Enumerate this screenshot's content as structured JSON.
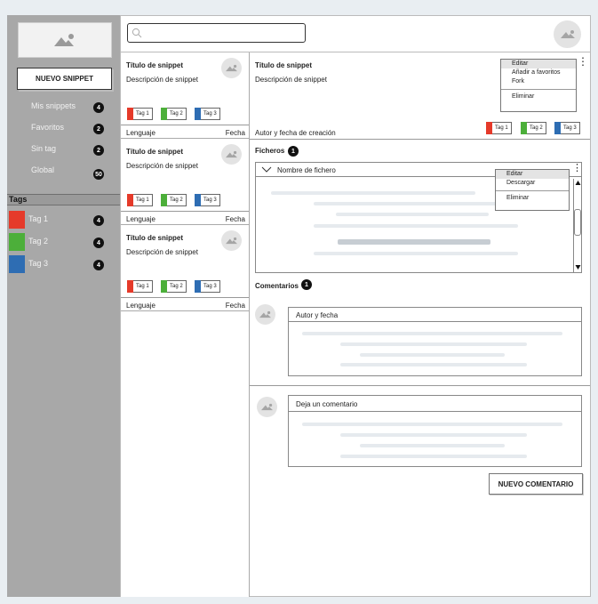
{
  "sidebar": {
    "new_snippet": "NUEVO SNIPPET",
    "nav": [
      {
        "label": "Mis snippets",
        "count": "4"
      },
      {
        "label": "Favoritos",
        "count": "2"
      },
      {
        "label": "Sin tag",
        "count": "2"
      },
      {
        "label": "Global",
        "count": "50"
      }
    ],
    "tags_header": "Tags",
    "tags": [
      {
        "label": "Tag 1",
        "count": "4",
        "color": "#e53a2a"
      },
      {
        "label": "Tag 2",
        "count": "4",
        "color": "#4caf3a"
      },
      {
        "label": "Tag 3",
        "count": "4",
        "color": "#2e6db3"
      }
    ]
  },
  "search": {
    "placeholder": ""
  },
  "snippets": [
    {
      "title": "Título de snippet",
      "description": "Descripción de snippet",
      "tags": [
        "Tag 1",
        "Tag 2",
        "Tag 3"
      ],
      "language": "Lenguaje",
      "date": "Fecha"
    },
    {
      "title": "Título de snippet",
      "description": "Descripción de snippet",
      "tags": [
        "Tag 1",
        "Tag 2",
        "Tag 3"
      ],
      "language": "Lenguaje",
      "date": "Fecha"
    },
    {
      "title": "Título de snippet",
      "description": "Descripción de snippet",
      "tags": [
        "Tag 1",
        "Tag 2",
        "Tag 3"
      ],
      "language": "Lenguaje",
      "date": "Fecha"
    }
  ],
  "detail": {
    "title": "Título de snippet",
    "description": "Descripción de snippet",
    "author_date": "Autor y fecha de creación",
    "tags": [
      "Tag 1",
      "Tag 2",
      "Tag 3"
    ],
    "more_glyph": "⋮",
    "menu": [
      "Editar",
      "Añadir a favoritos",
      "Fork",
      "Eliminar"
    ],
    "files_label": "Ficheros",
    "files_count": "1",
    "file_name": "Nombre de fichero",
    "file_menu": [
      "Editar",
      "Descargar",
      "Eliminar"
    ],
    "comments_label": "Comentarios",
    "comments_count": "1",
    "comment_author": "Autor y fecha",
    "new_comment_placeholder": "Deja un comentario",
    "new_comment_button": "NUEVO COMENTARIO"
  },
  "colors": {
    "tag1": "#e53a2a",
    "tag2": "#4caf3a",
    "tag3": "#2e6db3"
  }
}
